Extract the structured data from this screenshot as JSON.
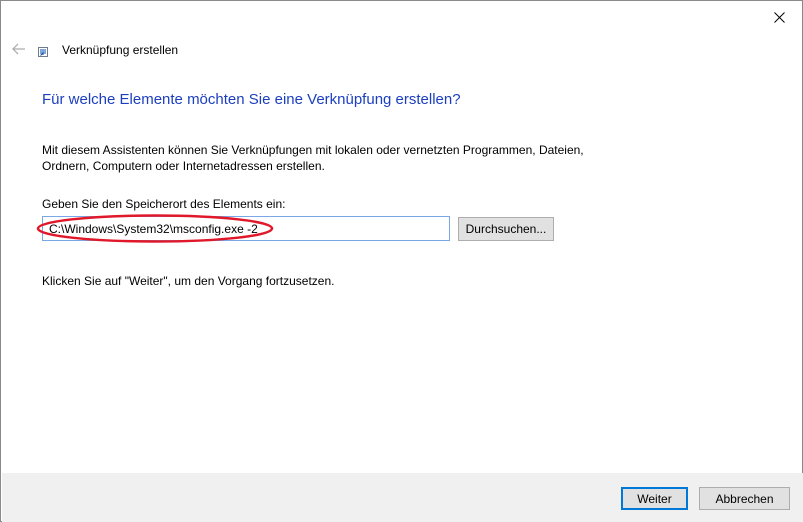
{
  "window": {
    "title": "Verknüpfung erstellen",
    "close_icon": "close-icon",
    "back_icon": "back-arrow-icon",
    "app_icon": "shortcut-icon"
  },
  "main": {
    "heading": "Für welche Elemente möchten Sie eine Verknüpfung erstellen?",
    "description_line1": "Mit diesem Assistenten können Sie Verknüpfungen mit lokalen oder vernetzten Programmen, Dateien,",
    "description_line2": "Ordnern, Computern oder Internetadressen erstellen.",
    "location_label": "Geben Sie den Speicherort des Elements ein:",
    "location_value": "C:\\Windows\\System32\\msconfig.exe -2",
    "browse_label": "Durchsuchen...",
    "hint": "Klicken Sie auf \"Weiter\", um den Vorgang fortzusetzen."
  },
  "footer": {
    "next_label": "Weiter",
    "cancel_label": "Abbrechen"
  },
  "colors": {
    "heading": "#1c3fbf",
    "highlight": "#e0192a",
    "input_border": "#7aa7e8",
    "footer_bg": "#f0f0f0"
  }
}
